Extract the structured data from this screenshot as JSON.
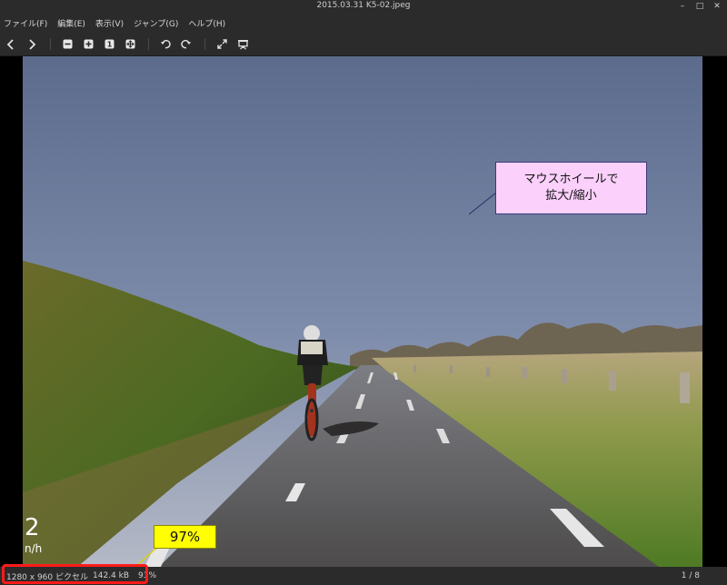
{
  "window": {
    "title": "2015.03.31 K5-02.jpeg",
    "controls": [
      "minimize-icon",
      "maximize-icon",
      "close-icon"
    ]
  },
  "menu": {
    "items": [
      "ファイル(F)",
      "編集(E)",
      "表示(V)",
      "ジャンプ(G)",
      "ヘルプ(H)"
    ]
  },
  "toolbar": {
    "icons": [
      "back-icon",
      "forward-icon",
      "zoom-out-icon",
      "zoom-in-icon",
      "actual-size-icon",
      "fit-window-icon",
      "rotate-left-icon",
      "rotate-right-icon",
      "fullscreen-icon",
      "slideshow-icon"
    ],
    "actual_size_glyph": "1"
  },
  "annotations": {
    "wheel_zoom_line1": "マウスホイールで",
    "wheel_zoom_line2": "拡大/縮小",
    "zoom_percent": "97%"
  },
  "photo_overlay": {
    "speed": "2",
    "unit": "n/h"
  },
  "status": {
    "dimensions": "1280 x 960 ピクセル",
    "filesize": "142.4 kB",
    "zoom": "93%",
    "position": "1 / 8"
  },
  "colors": {
    "highlight_red": "#ff1a1a",
    "callout_pink": "#fbd0fb",
    "callout_yellow": "#ffff00"
  }
}
